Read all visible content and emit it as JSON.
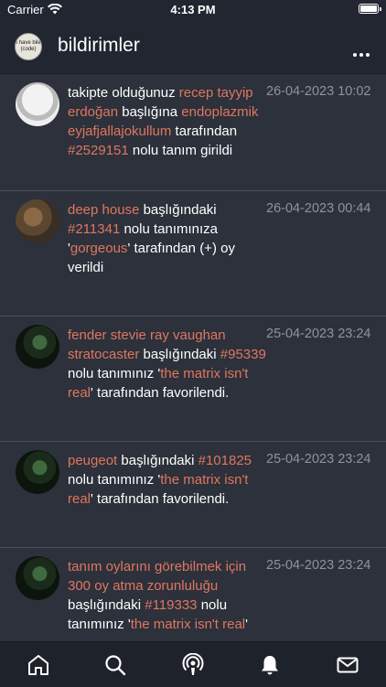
{
  "status_bar": {
    "carrier": "Carrier",
    "time": "4:13 PM"
  },
  "header": {
    "title": "bildirimler",
    "avatar_text": "I have bile (code)"
  },
  "colors": {
    "background": "#2c313b",
    "link": "#e07660",
    "date": "#8e939d"
  },
  "notifications": [
    {
      "date": "26-04-2023 10:02",
      "avatar": "finger-avatar",
      "parts": [
        {
          "t": "takipte olduğunuz ",
          "link": false
        },
        {
          "t": "recep tayyip erdoğan",
          "link": true
        },
        {
          "t": " başlığına ",
          "link": false
        },
        {
          "t": "endoplazmik eyjafjallajokullum",
          "link": true
        },
        {
          "t": " tarafından ",
          "link": false
        },
        {
          "t": "#2529151",
          "link": true
        },
        {
          "t": " nolu tanım girildi",
          "link": false
        }
      ]
    },
    {
      "date": "26-04-2023 00:44",
      "avatar": "portrait-avatar",
      "parts": [
        {
          "t": "deep house",
          "link": true
        },
        {
          "t": " başlığındaki ",
          "link": false
        },
        {
          "t": "#211341",
          "link": true
        },
        {
          "t": " nolu tanımınıza '",
          "link": false
        },
        {
          "t": "gorgeous",
          "link": true
        },
        {
          "t": "' tarafından (+) oy verildi",
          "link": false
        }
      ]
    },
    {
      "date": "25-04-2023 23:24",
      "avatar": "matrix-avatar",
      "parts": [
        {
          "t": "fender stevie ray vaughan stratocaster",
          "link": true
        },
        {
          "t": " başlığındaki ",
          "link": false
        },
        {
          "t": "#95339",
          "link": true
        },
        {
          "t": " nolu tanımınız '",
          "link": false
        },
        {
          "t": "the matrix isn't real",
          "link": true
        },
        {
          "t": "' tarafından favorilendi.",
          "link": false
        }
      ]
    },
    {
      "date": "25-04-2023 23:24",
      "avatar": "matrix-avatar",
      "parts": [
        {
          "t": "peugeot",
          "link": true
        },
        {
          "t": " başlığındaki ",
          "link": false
        },
        {
          "t": "#101825",
          "link": true
        },
        {
          "t": " nolu tanımınız '",
          "link": false
        },
        {
          "t": "the matrix isn't real",
          "link": true
        },
        {
          "t": "' tarafından favorilendi.",
          "link": false
        }
      ]
    },
    {
      "date": "25-04-2023 23:24",
      "avatar": "matrix-avatar",
      "parts": [
        {
          "t": "tanım oylarını görebilmek için 300 oy atma zorunluluğu",
          "link": true
        },
        {
          "t": " başlığındaki ",
          "link": false
        },
        {
          "t": "#119333",
          "link": true
        },
        {
          "t": " nolu tanımınız '",
          "link": false
        },
        {
          "t": "the matrix isn't real",
          "link": true
        },
        {
          "t": "'",
          "link": false
        }
      ]
    }
  ],
  "tabs": [
    {
      "icon": "home-icon"
    },
    {
      "icon": "search-icon"
    },
    {
      "icon": "podcast-icon"
    },
    {
      "icon": "bell-icon",
      "active": true
    },
    {
      "icon": "mail-icon"
    }
  ]
}
